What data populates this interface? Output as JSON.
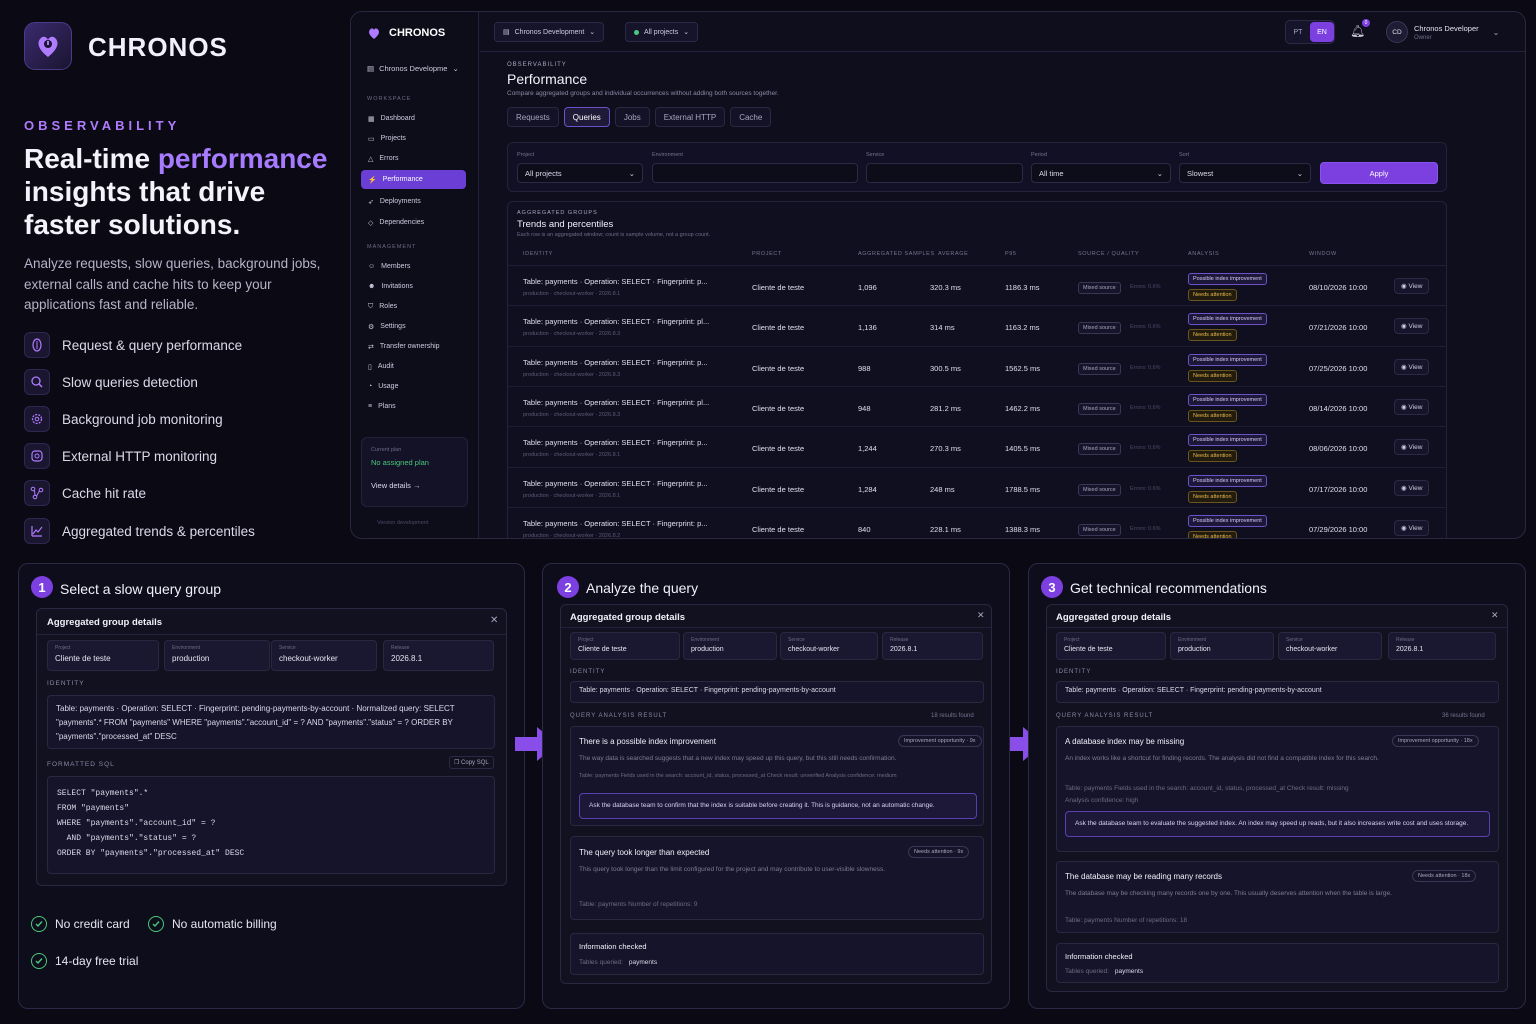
{
  "hero": {
    "brand": "CHRONOS",
    "eyebrow": "OBSERVABILITY",
    "headline_pre": "Real-time ",
    "headline_hl": "performance",
    "headline_post": " insights that drive faster solutions.",
    "lead": "Analyze requests, slow queries, background jobs, external calls and cache hits to keep your applications fast and reliable.",
    "features": [
      {
        "label": "Request & query performance",
        "icon": "gauge-icon"
      },
      {
        "label": "Slow queries detection",
        "icon": "search-icon"
      },
      {
        "label": "Background job monitoring",
        "icon": "gear-icon"
      },
      {
        "label": "External HTTP monitoring",
        "icon": "globe-icon"
      },
      {
        "label": "Cache hit rate",
        "icon": "nodes-icon"
      },
      {
        "label": "Aggregated trends & percentiles",
        "icon": "chart-icon"
      }
    ]
  },
  "app": {
    "brand": "CHRONOS",
    "workspace": "Chronos Developme",
    "sections": {
      "workspace": "WORKSPACE",
      "management": "MANAGEMENT"
    },
    "nav_workspace": [
      "Dashboard",
      "Projects",
      "Errors",
      "Performance",
      "Deployments",
      "Dependencies"
    ],
    "nav_management": [
      "Members",
      "Invitations",
      "Roles",
      "Settings",
      "Transfer ownership",
      "Audit",
      "Usage",
      "Plans"
    ],
    "plan": {
      "label": "Current plan",
      "value": "No assigned plan",
      "link": "View details →"
    },
    "version": "Version development",
    "topbar": {
      "org": "Chronos Development",
      "projects": "All projects",
      "lang_pt": "PT",
      "lang_en": "EN",
      "notif_count": "0",
      "avatar": "CD",
      "user_name": "Chronos Developer",
      "user_role": "Owner"
    },
    "page": {
      "eyebrow": "OBSERVABILITY",
      "title": "Performance",
      "subtitle": "Compare aggregated groups and individual occurrences without adding both sources together."
    },
    "tabs": [
      "Requests",
      "Queries",
      "Jobs",
      "External HTTP",
      "Cache"
    ],
    "active_tab": "Queries",
    "filters": {
      "project_label": "Project",
      "project": "All projects",
      "environment_label": "Environment",
      "environment": "",
      "service_label": "Service",
      "service": "",
      "period_label": "Period",
      "period": "All time",
      "sort_label": "Sort",
      "sort": "Slowest",
      "apply": "Apply"
    },
    "table": {
      "eyebrow": "AGGREGATED GROUPS",
      "title": "Trends and percentiles",
      "subtitle": "Each row is an aggregated window; count is sample volume, not a group count.",
      "headers": [
        "IDENTITY",
        "PROJECT",
        "AGGREGATED SAMPLES",
        "AVERAGE",
        "P95",
        "SOURCE / QUALITY",
        "ANALYSIS",
        "WINDOW"
      ],
      "source": "Mixed source",
      "errors": "Errors: 0.6%",
      "tag1": "Possible index improvement",
      "tag2": "Needs attention",
      "view": "View",
      "rows": [
        {
          "identity": "Table: payments · Operation: SELECT · Fingerprint: p...",
          "meta": "production · checkout-worker · 2026.8.1",
          "project": "Cliente de teste",
          "samples": "1,096",
          "avg": "320.3 ms",
          "p95": "1186.3 ms",
          "window": "08/10/2026 10:00"
        },
        {
          "identity": "Table: payments · Operation: SELECT · Fingerprint: pl...",
          "meta": "production · checkout-worker · 2026.8.3",
          "project": "Cliente de teste",
          "samples": "1,136",
          "avg": "314 ms",
          "p95": "1163.2 ms",
          "window": "07/21/2026 10:00"
        },
        {
          "identity": "Table: payments · Operation: SELECT · Fingerprint: p...",
          "meta": "production · checkout-worker · 2026.8.3",
          "project": "Cliente de teste",
          "samples": "988",
          "avg": "300.5 ms",
          "p95": "1562.5 ms",
          "window": "07/25/2026 10:00"
        },
        {
          "identity": "Table: payments · Operation: SELECT · Fingerprint: pl...",
          "meta": "production · checkout-worker · 2026.8.3",
          "project": "Cliente de teste",
          "samples": "948",
          "avg": "281.2 ms",
          "p95": "1462.2 ms",
          "window": "08/14/2026 10:00"
        },
        {
          "identity": "Table: payments · Operation: SELECT · Fingerprint: p...",
          "meta": "production · checkout-worker · 2026.8.1",
          "project": "Cliente de teste",
          "samples": "1,244",
          "avg": "270.3 ms",
          "p95": "1405.5 ms",
          "window": "08/06/2026 10:00"
        },
        {
          "identity": "Table: payments · Operation: SELECT · Fingerprint: p...",
          "meta": "production · checkout-worker · 2026.8.1",
          "project": "Cliente de teste",
          "samples": "1,284",
          "avg": "248 ms",
          "p95": "1788.5 ms",
          "window": "07/17/2026 10:00"
        },
        {
          "identity": "Table: payments · Operation: SELECT · Fingerprint: p...",
          "meta": "production · checkout-worker · 2026.8.2",
          "project": "Cliente de teste",
          "samples": "840",
          "avg": "228.1 ms",
          "p95": "1388.3 ms",
          "window": "07/29/2026 10:00"
        }
      ]
    }
  },
  "steps": [
    {
      "num": "1",
      "title": "Select a slow query group"
    },
    {
      "num": "2",
      "title": "Analyze the query"
    },
    {
      "num": "3",
      "title": "Get technical recommendations"
    }
  ],
  "details": {
    "title": "Aggregated group details",
    "kv": [
      {
        "k": "Project",
        "v": "Cliente de teste"
      },
      {
        "k": "Environment",
        "v": "production"
      },
      {
        "k": "Service",
        "v": "checkout-worker"
      },
      {
        "k": "Release",
        "v": "2026.8.1"
      }
    ],
    "identity_label": "IDENTITY",
    "identity_full": "Table: payments · Operation: SELECT · Fingerprint: pending-payments-by-account · Normalized query: SELECT \"payments\".* FROM \"payments\" WHERE \"payments\".\"account_id\" = ? AND \"payments\".\"status\" = ? ORDER BY \"payments\".\"processed_at\" DESC",
    "identity_short": "Table: payments · Operation: SELECT · Fingerprint: pending-payments-by-account",
    "sql_label": "FORMATTED SQL",
    "copy_sql": "Copy SQL",
    "sql": "SELECT \"payments\".*\nFROM \"payments\"\nWHERE \"payments\".\"account_id\" = ?\n  AND \"payments\".\"status\" = ?\nORDER BY \"payments\".\"processed_at\" DESC",
    "qa_label": "QUERY ANALYSIS RESULT"
  },
  "card2": {
    "found": "18 results found",
    "r1": {
      "title": "There is a possible index improvement",
      "badge": "Improvement opportunity · 9x",
      "desc": "The way data is searched suggests that a new index may speed up this query, but this still needs confirmation.",
      "meta": "Table: payments   Fields used in the search: account_id, status, processed_at   Check result: unverified   Analysis confidence: medium",
      "note": "Ask the database team to confirm that the index is suitable before creating it. This is guidance, not an automatic change."
    },
    "r2": {
      "title": "The query took longer than expected",
      "badge": "Needs attention · 9x",
      "desc": "This query took longer than the limit configured for the project and may contribute to user-visible slowness.",
      "meta": "Table: payments   Number of repetitions: 9"
    },
    "info": {
      "title": "Information checked",
      "label": "Tables queried:",
      "value": "payments"
    }
  },
  "card3": {
    "found": "36 results found",
    "r1": {
      "title": "A database index may be missing",
      "badge": "Improvement opportunity · 18x",
      "desc": "An index works like a shortcut for finding records. The analysis did not find a compatible index for this search.",
      "meta": "Table: payments   Fields used in the search: account_id, status, processed_at   Check result: missing",
      "meta2": "Analysis confidence: high",
      "note": "Ask the database team to evaluate the suggested index. An index may speed up reads, but it also increases write cost and uses storage."
    },
    "r2": {
      "title": "The database may be reading many records",
      "badge": "Needs attention · 18x",
      "desc": "The database may be checking many records one by one. This usually deserves attention when the table is large.",
      "meta": "Table: payments   Number of repetitions: 18"
    },
    "info": {
      "title": "Information checked",
      "label": "Tables queried:",
      "value": "payments"
    }
  },
  "perks": [
    "No credit card",
    "No automatic billing",
    "14-day free trial"
  ],
  "colors": {
    "accent": "#7c3fe0",
    "warning": "#e9b84a",
    "success": "#4ac97a"
  }
}
